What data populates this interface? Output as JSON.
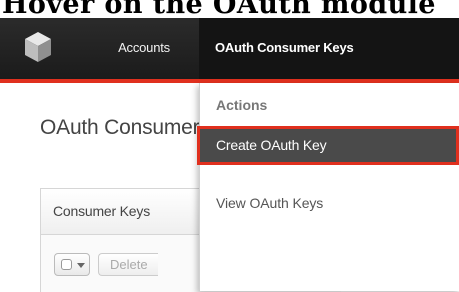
{
  "caption": "Hover on the OAuth module",
  "navbar": {
    "logo_icon": "cube-icon",
    "items": [
      {
        "label": "Accounts"
      },
      {
        "label": "OAuth Consumer Keys"
      }
    ],
    "accent_color": "#e0301e"
  },
  "page": {
    "title": "OAuth Consumer Keys",
    "panel": {
      "header": "Consumer Keys",
      "toolbar": {
        "delete_label": "Delete"
      }
    }
  },
  "dropdown": {
    "header": "Actions",
    "items": [
      {
        "label": "Create OAuth Key",
        "highlighted": true
      },
      {
        "label": "View OAuth Keys"
      }
    ]
  }
}
